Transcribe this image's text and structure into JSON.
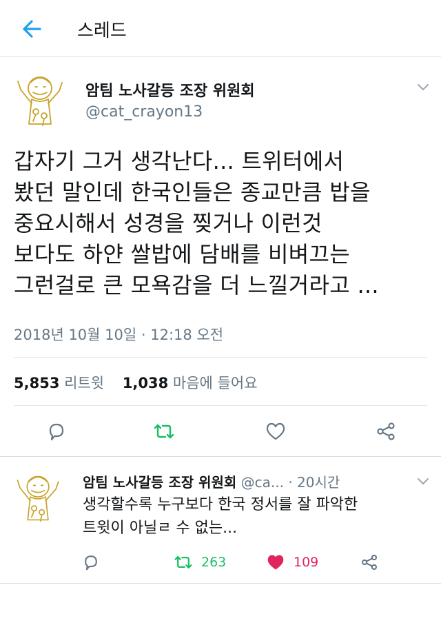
{
  "header": {
    "title": "스레드"
  },
  "tweet": {
    "name": "암팀 노사갈등 조장 위원회",
    "handle": "@cat_crayon13",
    "lines": [
      "갑자기 그거 생각난다... 트위터에서",
      "봤던 말인데 한국인들은 종교만큼 밥을",
      "중요시해서 성경을 찢거나 이런것",
      "보다도 하얀 쌀밥에 담배를 비벼끄는",
      "그런걸로 큰 모욕감을 더 느낄거라고 ..."
    ],
    "timestamp": "2018년 10월 10일 · 12:18 오전",
    "retweets_count": "5,853",
    "retweets_label": "리트윗",
    "likes_count": "1,038",
    "likes_label": "마음에 들어요"
  },
  "reply": {
    "name": "암팀 노사갈등 조장 위원회",
    "handle": "@ca...",
    "time": "· 20시간",
    "lines": [
      "생각할수록 누구보다 한국 정서를 잘 파악한",
      "트윗이 아닐ㄹ 수 없는..."
    ],
    "retweet_count": "263",
    "like_count": "109"
  },
  "colors": {
    "retweet_green": "#17bf63",
    "like_red": "#e0245e",
    "link_blue": "#1da1f2",
    "gray": "#657786"
  },
  "icons": [
    "back-arrow-icon",
    "chevron-down-icon",
    "reply-icon",
    "retweet-icon",
    "heart-icon",
    "share-icon"
  ]
}
